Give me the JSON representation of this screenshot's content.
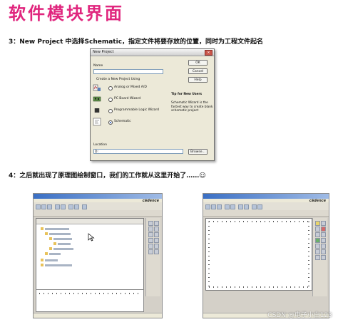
{
  "title": "软件模块界面",
  "step3": "3：New Project 中选择Schematic，指定文件将要存放的位置，同时为工程文件起名",
  "step4": "4：之后就出现了原理图绘制窗口，我们的工作就从这里开始了……☺",
  "dialog": {
    "title": "New Project",
    "name_label": "Name",
    "name_value": "",
    "create_label": "Create a New Project Using",
    "options": [
      "Analog or Mixed A/D",
      "PC Board Wizard",
      "Programmable Logic Wizard",
      "Schematic"
    ],
    "selected_index": 3,
    "ok_label": "OK",
    "cancel_label": "Cancel",
    "help_label": "Help",
    "tip_title": "Tip for New Users",
    "tip_lines": [
      "Schematic Wizard is the",
      "fastest way to create blank",
      "schematic project"
    ],
    "location_label": "Location",
    "location_value": "D:",
    "browse_label": "Browse..."
  },
  "screenshots": {
    "brand": "cādence"
  },
  "watermark": "CSDN @电子小白123"
}
